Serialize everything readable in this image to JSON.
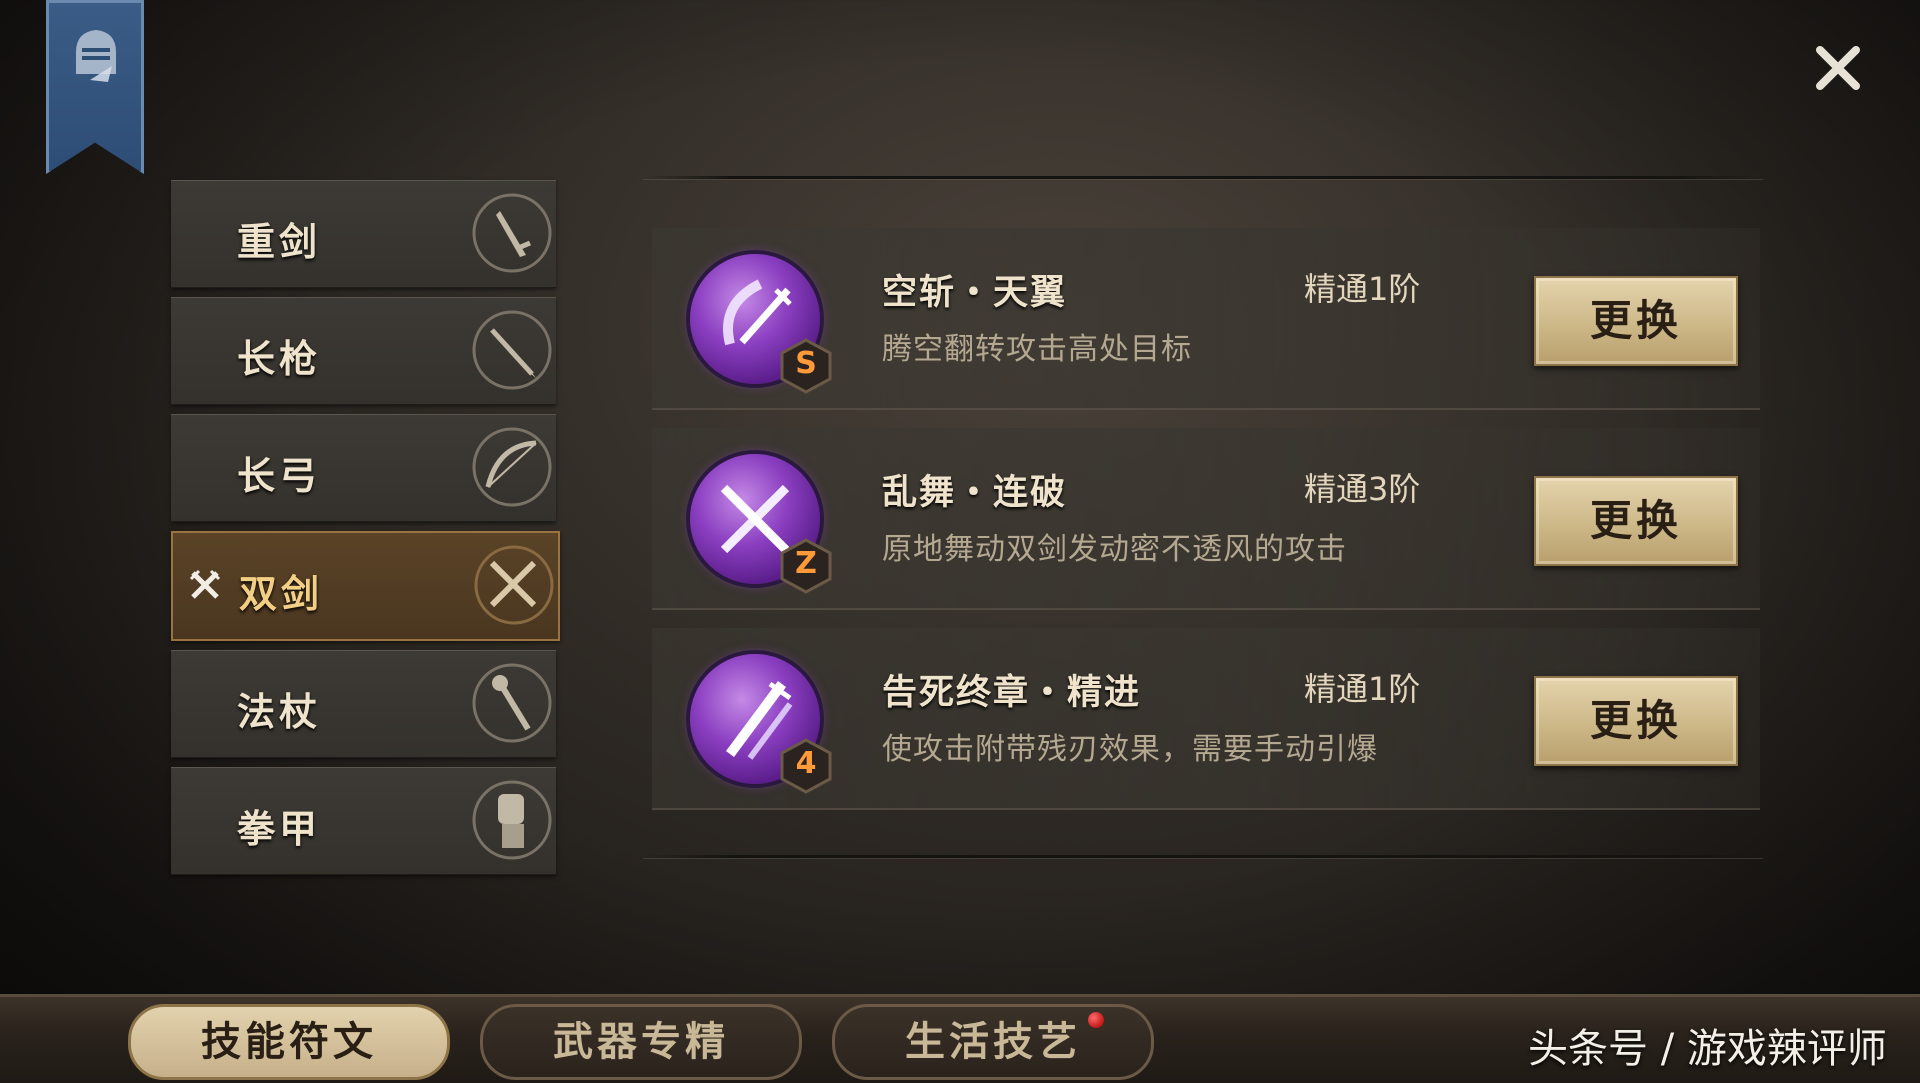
{
  "weapons": [
    {
      "label": "重剑",
      "icon": "greatsword-icon",
      "active": false
    },
    {
      "label": "长枪",
      "icon": "spear-icon",
      "active": false
    },
    {
      "label": "长弓",
      "icon": "longbow-icon",
      "active": false
    },
    {
      "label": "双剑",
      "icon": "dual-swords-icon",
      "active": true
    },
    {
      "label": "法杖",
      "icon": "staff-icon",
      "active": false
    },
    {
      "label": "拳甲",
      "icon": "gauntlet-icon",
      "active": false
    }
  ],
  "skills": [
    {
      "name": "空斩・天翼",
      "level": "精通1阶",
      "description": "腾空翻转攻击高处目标",
      "rune": "S",
      "button": "更换"
    },
    {
      "name": "乱舞・连破",
      "level": "精通3阶",
      "description": "原地舞动双剑发动密不透风的攻击",
      "rune": "Z",
      "button": "更换"
    },
    {
      "name": "告死终章・精进",
      "level": "精通1阶",
      "description": "使攻击附带残刃效果，需要手动引爆",
      "rune": "4",
      "button": "更换"
    }
  ],
  "tabs": [
    {
      "label": "技能符文",
      "active": true
    },
    {
      "label": "武器专精",
      "active": false
    },
    {
      "label": "生活技艺",
      "active": false,
      "notification": true
    }
  ],
  "watermark": "头条号 / 游戏辣评师",
  "colors": {
    "accent_gold": "#f3cf86",
    "orb_purple": "#8b3fc1",
    "button_parchment": "#cdb888",
    "banner_blue": "#2d4d75",
    "notification_red": "#c41818"
  }
}
